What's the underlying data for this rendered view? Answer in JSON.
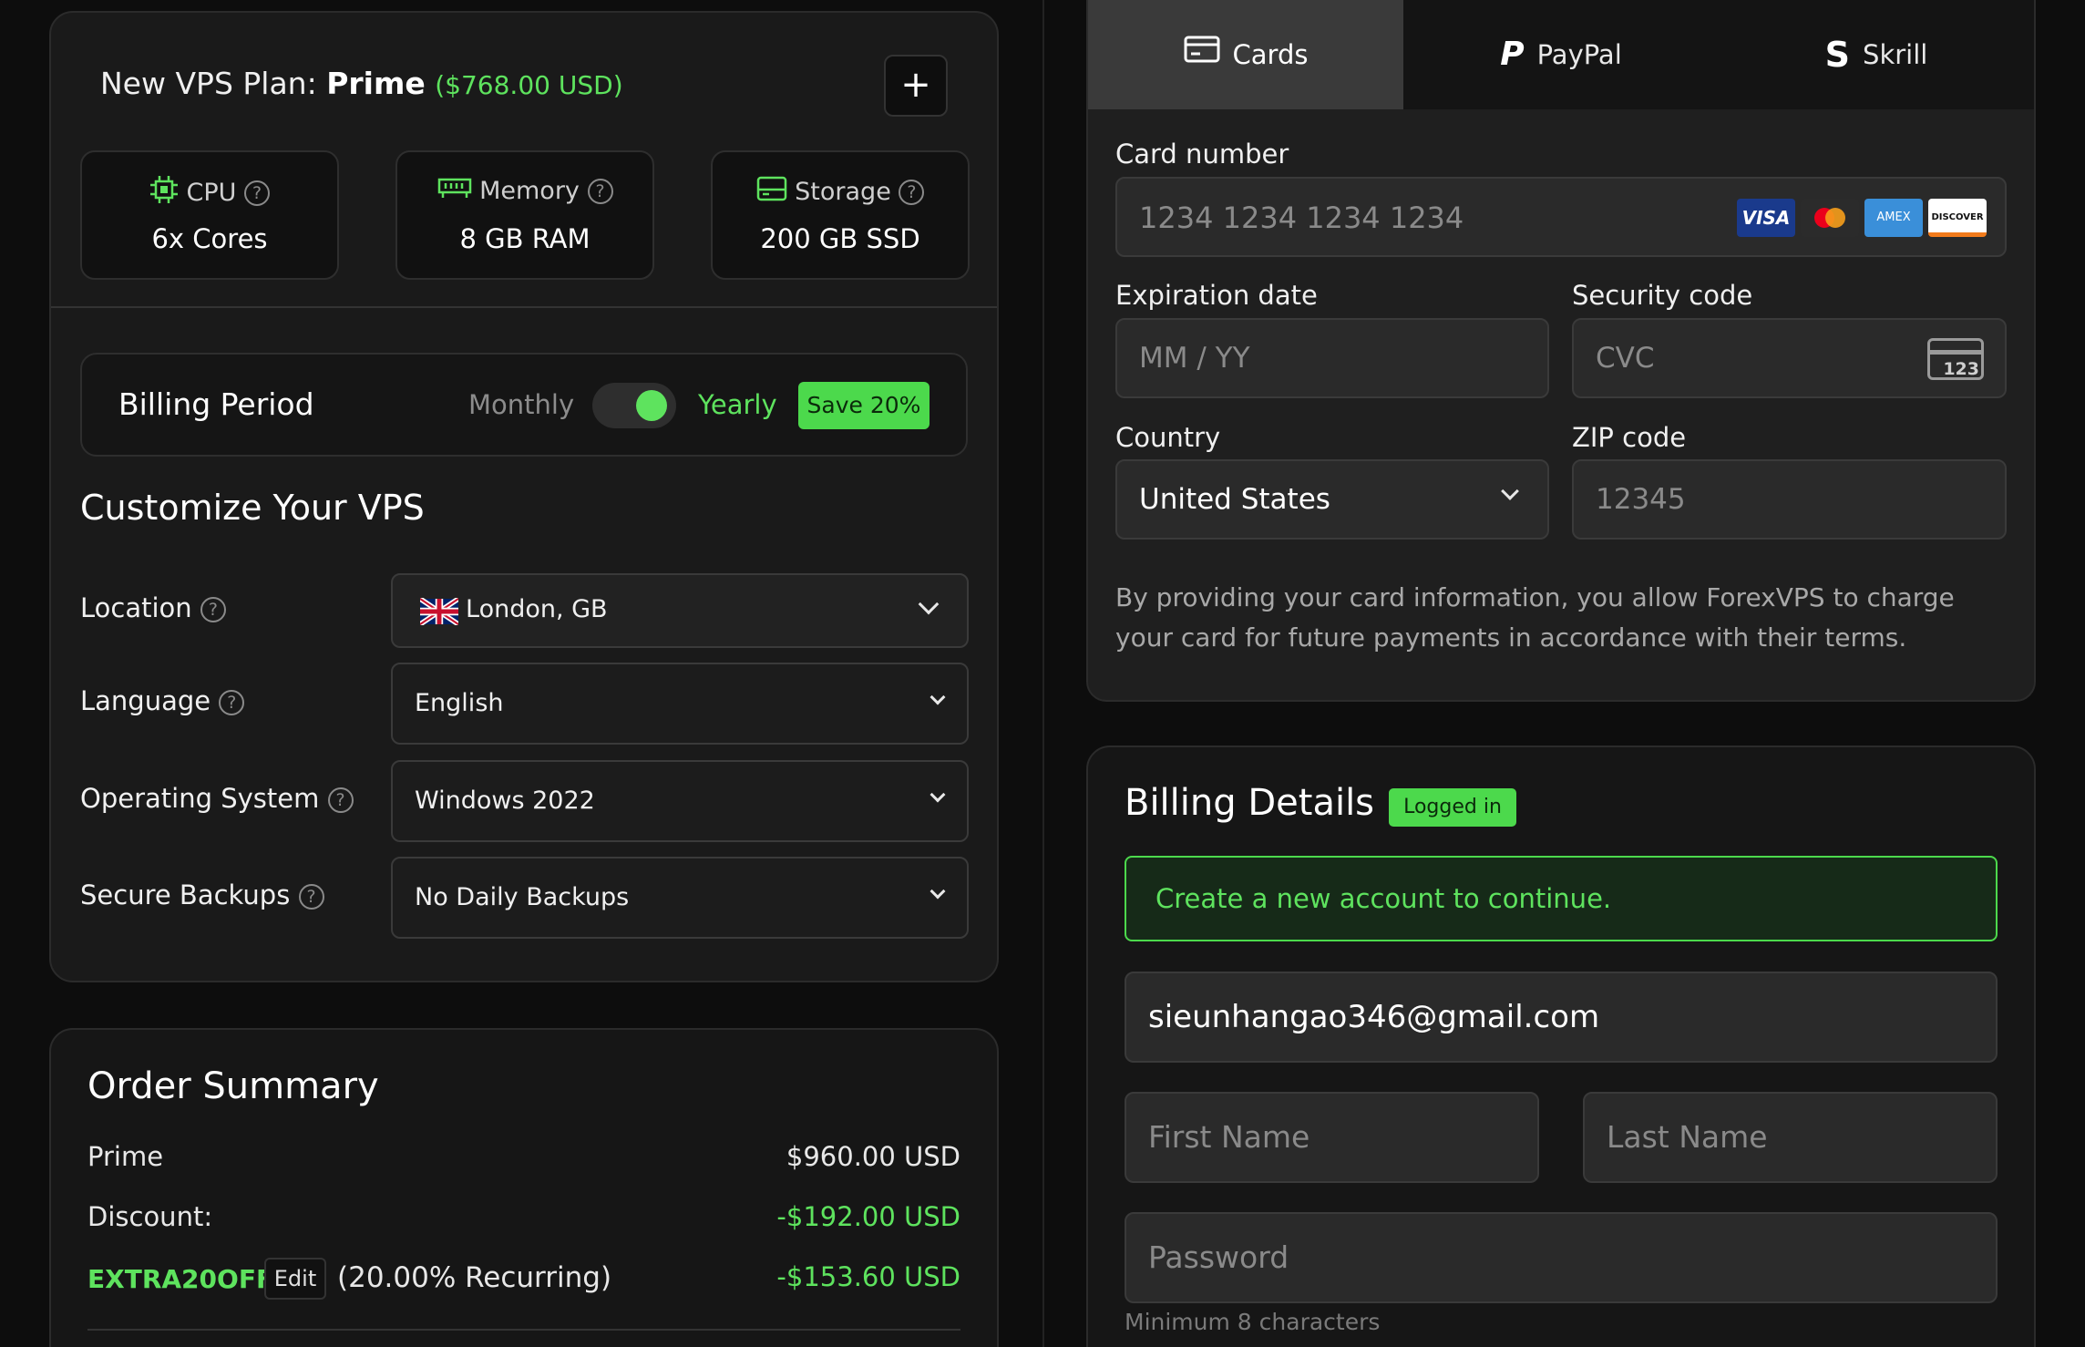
{
  "plan": {
    "title_prefix": "New VPS Plan:",
    "plan_name": "Prime",
    "price": "($768.00 USD)",
    "add_symbol": "+"
  },
  "specs": [
    {
      "label": "CPU",
      "value": "6x Cores",
      "icon": "cpu-icon"
    },
    {
      "label": "Memory",
      "value": "8 GB RAM",
      "icon": "memory-icon"
    },
    {
      "label": "Storage",
      "value": "200 GB SSD",
      "icon": "storage-icon"
    }
  ],
  "billing": {
    "title": "Billing Period",
    "monthly": "Monthly",
    "yearly": "Yearly",
    "save_badge": "Save 20%",
    "toggle_on": true
  },
  "customize": {
    "title": "Customize Your VPS",
    "rows": [
      {
        "label": "Location",
        "value": "London, GB"
      },
      {
        "label": "Language",
        "value": "English"
      },
      {
        "label": "Operating System",
        "value": "Windows 2022"
      },
      {
        "label": "Secure Backups",
        "value": "No Daily Backups"
      }
    ]
  },
  "summary": {
    "title": "Order Summary",
    "prime_label": "Prime",
    "prime_value": "$960.00 USD",
    "discount_label": "Discount:",
    "discount_value": "-$192.00 USD",
    "coupon_code": "EXTRA20OFF",
    "edit_label": "Edit",
    "coupon_note": "(20.00% Recurring)",
    "coupon_value": "-$153.60 USD"
  },
  "payment": {
    "tabs": [
      "Cards",
      "PayPal",
      "Skrill"
    ],
    "active_tab": "Cards",
    "card_number_label": "Card number",
    "card_number_placeholder": "1234 1234 1234 1234",
    "brands": [
      "VISA",
      "AMEX",
      "DISCOVER"
    ],
    "expiry_label": "Expiration date",
    "expiry_placeholder": "MM / YY",
    "cvc_label": "Security code",
    "cvc_placeholder": "CVC",
    "cvc_icon_text": "123",
    "country_label": "Country",
    "country_value": "United States",
    "zip_label": "ZIP code",
    "zip_placeholder": "12345",
    "disclaimer": "By providing your card information, you allow ForexVPS to charge your card for future payments in accordance with their terms."
  },
  "billing_details": {
    "title": "Billing Details",
    "badge": "Logged in",
    "notice": "Create a new account to continue.",
    "email": "sieunhangao346@gmail.com",
    "first_name_placeholder": "First Name",
    "last_name_placeholder": "Last Name",
    "password_placeholder": "Password",
    "password_hint": "Minimum 8 characters"
  },
  "colors": {
    "accent_green": "#5ee35e",
    "badge_green": "#4cd94c",
    "panel": "#1a1a1a",
    "field": "#2a2a2a"
  }
}
